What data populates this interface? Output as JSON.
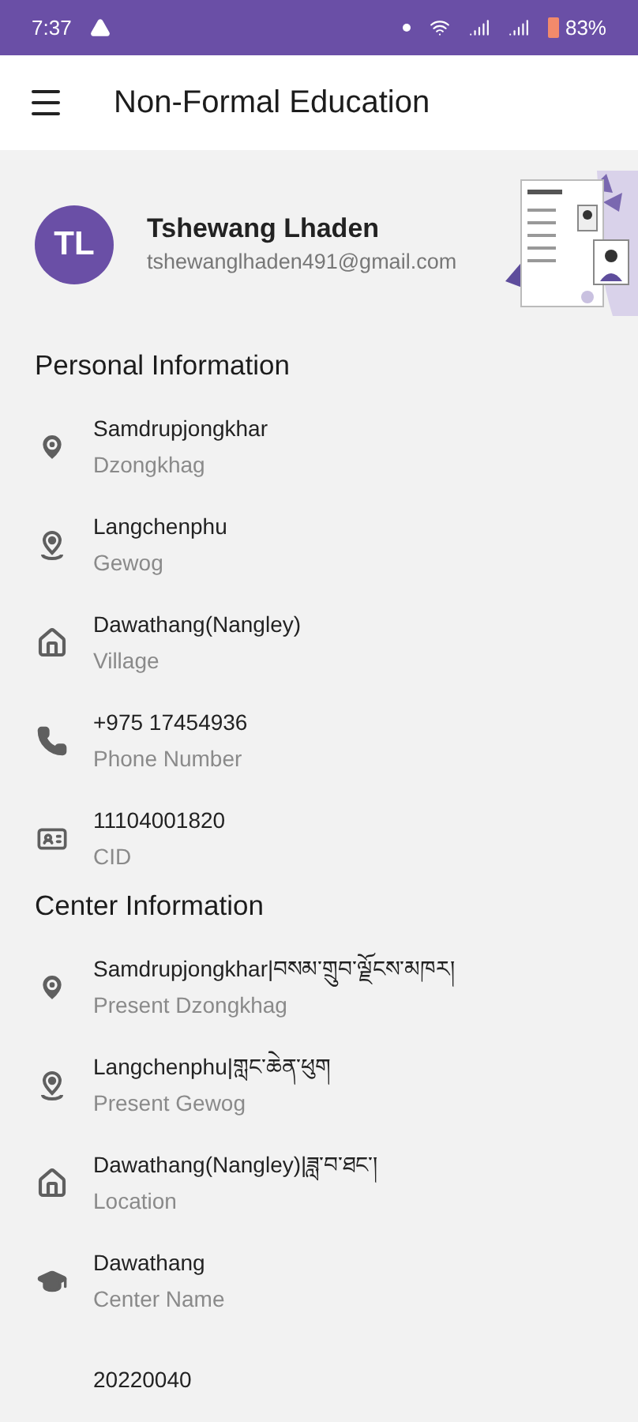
{
  "status_bar": {
    "time": "7:37",
    "battery": "83%"
  },
  "app_bar": {
    "title": "Non-Formal Education"
  },
  "profile": {
    "initials": "TL",
    "name": "Tshewang Lhaden",
    "email": "tshewanglhaden491@gmail.com"
  },
  "sections": [
    {
      "title": "Personal Information",
      "items": [
        {
          "kind": "pin",
          "value": "Samdrupjongkhar",
          "label": "Dzongkhag"
        },
        {
          "kind": "person-pin",
          "value": "Langchenphu",
          "label": "Gewog"
        },
        {
          "kind": "home",
          "value": "Dawathang(Nangley)",
          "label": "Village"
        },
        {
          "kind": "phone",
          "value": "+975 17454936",
          "label": "Phone Number"
        },
        {
          "kind": "id",
          "value": "11104001820",
          "label": "CID"
        }
      ]
    },
    {
      "title": "Center Information",
      "items": [
        {
          "kind": "pin",
          "value": "Samdrupjongkhar|བསམ་གྲུབ་ལྗོངས་མཁར།",
          "label": "Present Dzongkhag"
        },
        {
          "kind": "person-pin",
          "value": "Langchenphu|གླང་ཆེན་ཕུག",
          "label": "Present Gewog"
        },
        {
          "kind": "home",
          "value": "Dawathang(Nangley)|ཟླ་བ་ཐང་།",
          "label": "Location"
        },
        {
          "kind": "school",
          "value": "Dawathang",
          "label": "Center Name"
        },
        {
          "kind": "none",
          "value": "20220040"
        }
      ]
    }
  ]
}
